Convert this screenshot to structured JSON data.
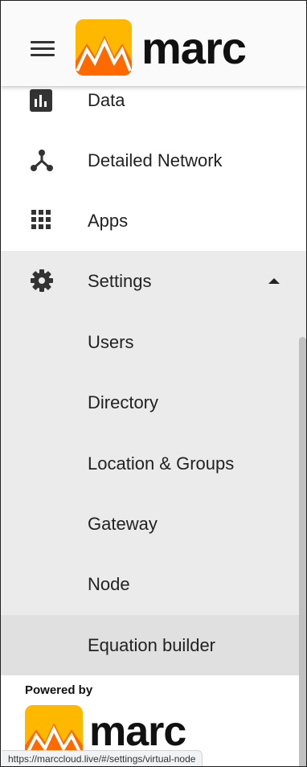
{
  "header": {
    "brand": "marc",
    "brand_color": "#ffb800"
  },
  "nav": {
    "items": [
      {
        "label": "Data",
        "icon": "bar-chart-icon"
      },
      {
        "label": "Detailed Network",
        "icon": "network-icon"
      },
      {
        "label": "Apps",
        "icon": "apps-grid-icon"
      }
    ],
    "settings": {
      "label": "Settings",
      "icon": "gear-icon",
      "expanded": true,
      "children": [
        {
          "label": "Users"
        },
        {
          "label": "Directory"
        },
        {
          "label": "Location & Groups"
        },
        {
          "label": "Gateway"
        },
        {
          "label": "Node"
        },
        {
          "label": "Equation builder",
          "active": true
        }
      ]
    }
  },
  "footer": {
    "powered_by": "Powered by",
    "brand": "marc"
  },
  "status_bar": {
    "url": "https://marccloud.live/#/settings/virtual-node"
  }
}
